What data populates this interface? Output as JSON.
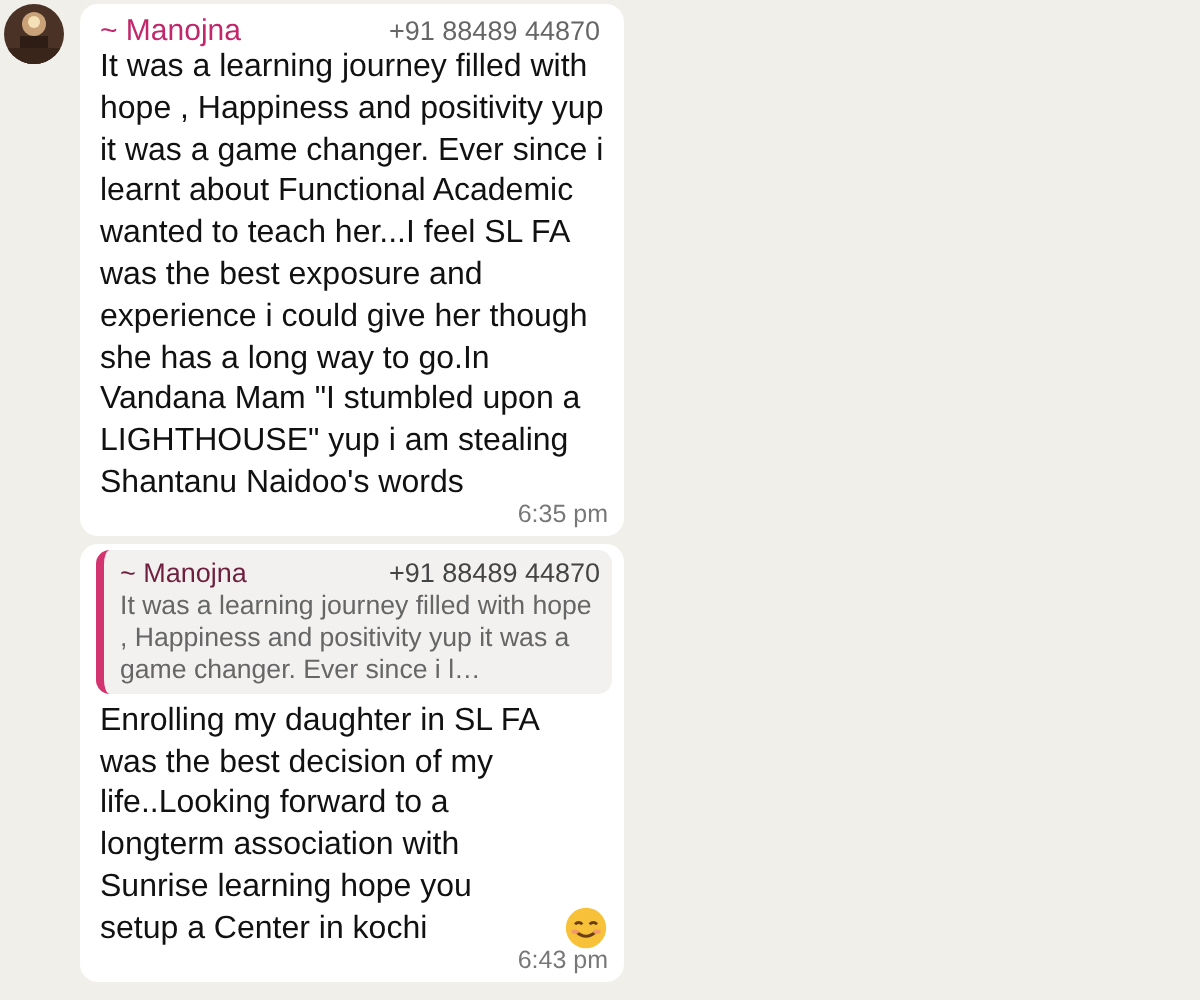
{
  "messages": [
    {
      "kind": "text",
      "sender": "~ Manojna",
      "phone": "+91 88489 44870",
      "show_avatar": true,
      "text": "It was a learning journey filled with hope , Happiness and positivity yup it was a game changer. Ever since i learnt about Functional Academic wanted to teach her...I feel SL FA was the best exposure and experience i could give her though she has a long way to go.In Vandana Mam \"I stumbled upon a LIGHTHOUSE\" yup i am stealing Shantanu Naidoo's words",
      "time": "6:35 pm"
    },
    {
      "kind": "reply",
      "show_avatar": false,
      "quote": {
        "sender": "~ Manojna",
        "phone": "+91 88489 44870",
        "text": "It was a learning journey filled with hope , Happiness and positivity yup it was a game changer. Ever since i l…"
      },
      "text": "Enrolling my daughter in SL FA was the best decision of my life..Looking forward to a longterm association with Sunrise learning hope you setup a Center in kochi",
      "time": "6:43 pm"
    }
  ]
}
